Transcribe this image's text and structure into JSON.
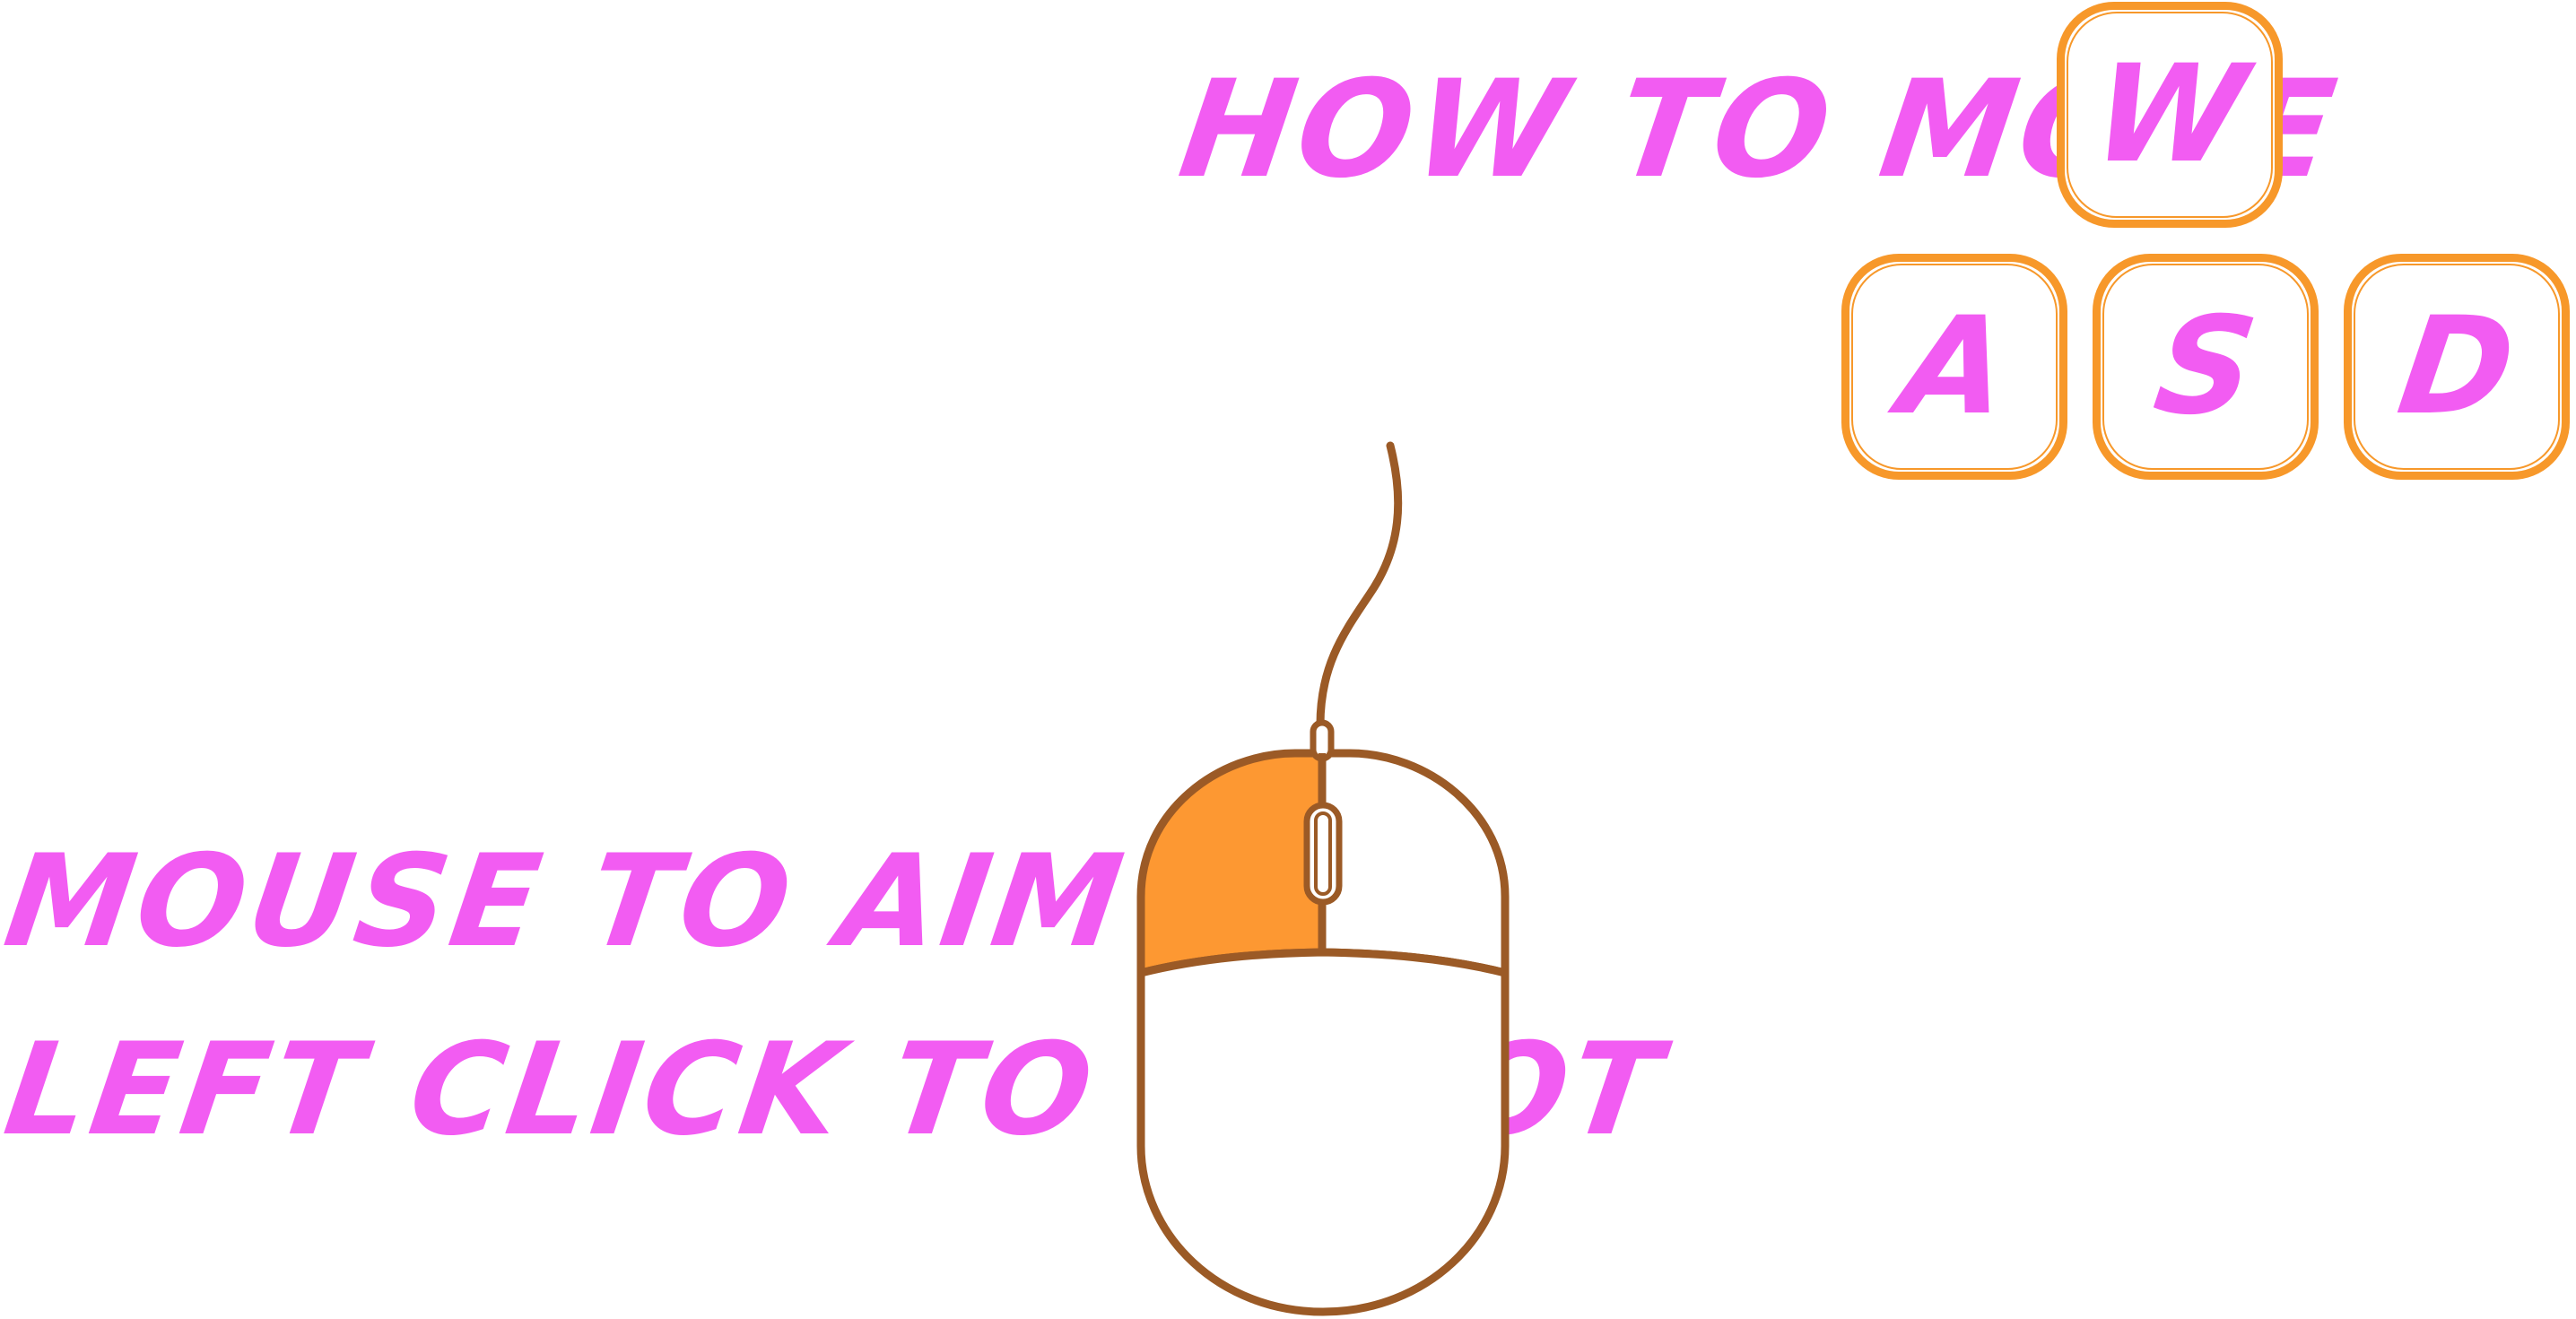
{
  "colors": {
    "text": "#f25cf2",
    "key_border": "#f7982a",
    "mouse_outline": "#9b5a26",
    "mouse_left_button_fill": "#fd9832",
    "background": "#ffffff"
  },
  "movement": {
    "title": "HOW TO MOVE",
    "keys": [
      "W",
      "A",
      "S",
      "D"
    ]
  },
  "aim": {
    "text": "MOUSE TO AIM"
  },
  "shoot": {
    "text": "LEFT CLICK TO SHOOT"
  },
  "mouse": {
    "icon": "mouse-icon",
    "highlighted_button": "left"
  }
}
